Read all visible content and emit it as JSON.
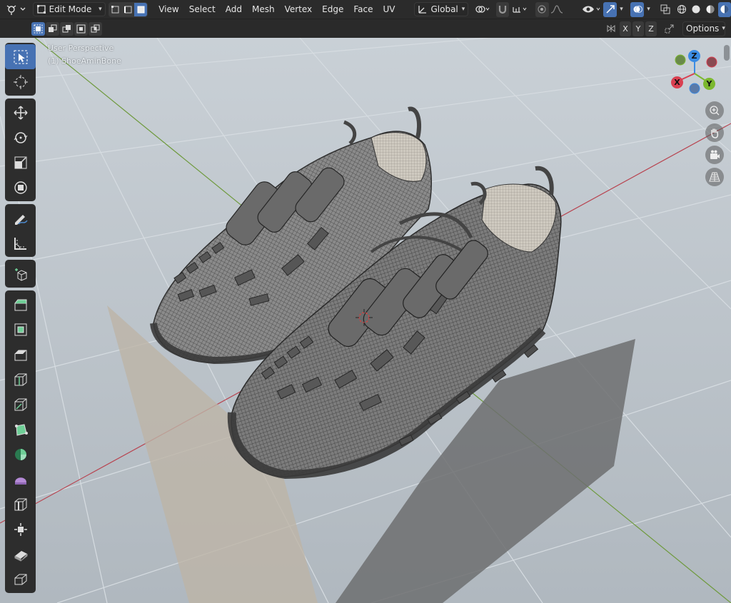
{
  "header": {
    "mode": "Edit Mode",
    "menus": [
      "View",
      "Select",
      "Add",
      "Mesh",
      "Vertex",
      "Edge",
      "Face",
      "UV"
    ],
    "transform_orientation": "Global"
  },
  "toolrow": {
    "axes": [
      "X",
      "Y",
      "Z"
    ],
    "options_label": "Options"
  },
  "viewport": {
    "view_name": "User Perspective",
    "object_label": "(1) ShoeAminBone"
  },
  "gizmo": {
    "x_label": "X",
    "y_label": "Y",
    "z_label": "Z",
    "x_color": "#d94051",
    "y_color": "#7cb82f",
    "z_color": "#3b8ce4"
  },
  "colors": {
    "accent": "#4772b3",
    "header_bg": "#2b2b2b",
    "viewport_bg": "#b7bfc6",
    "mesh": "#7d7d7d"
  }
}
